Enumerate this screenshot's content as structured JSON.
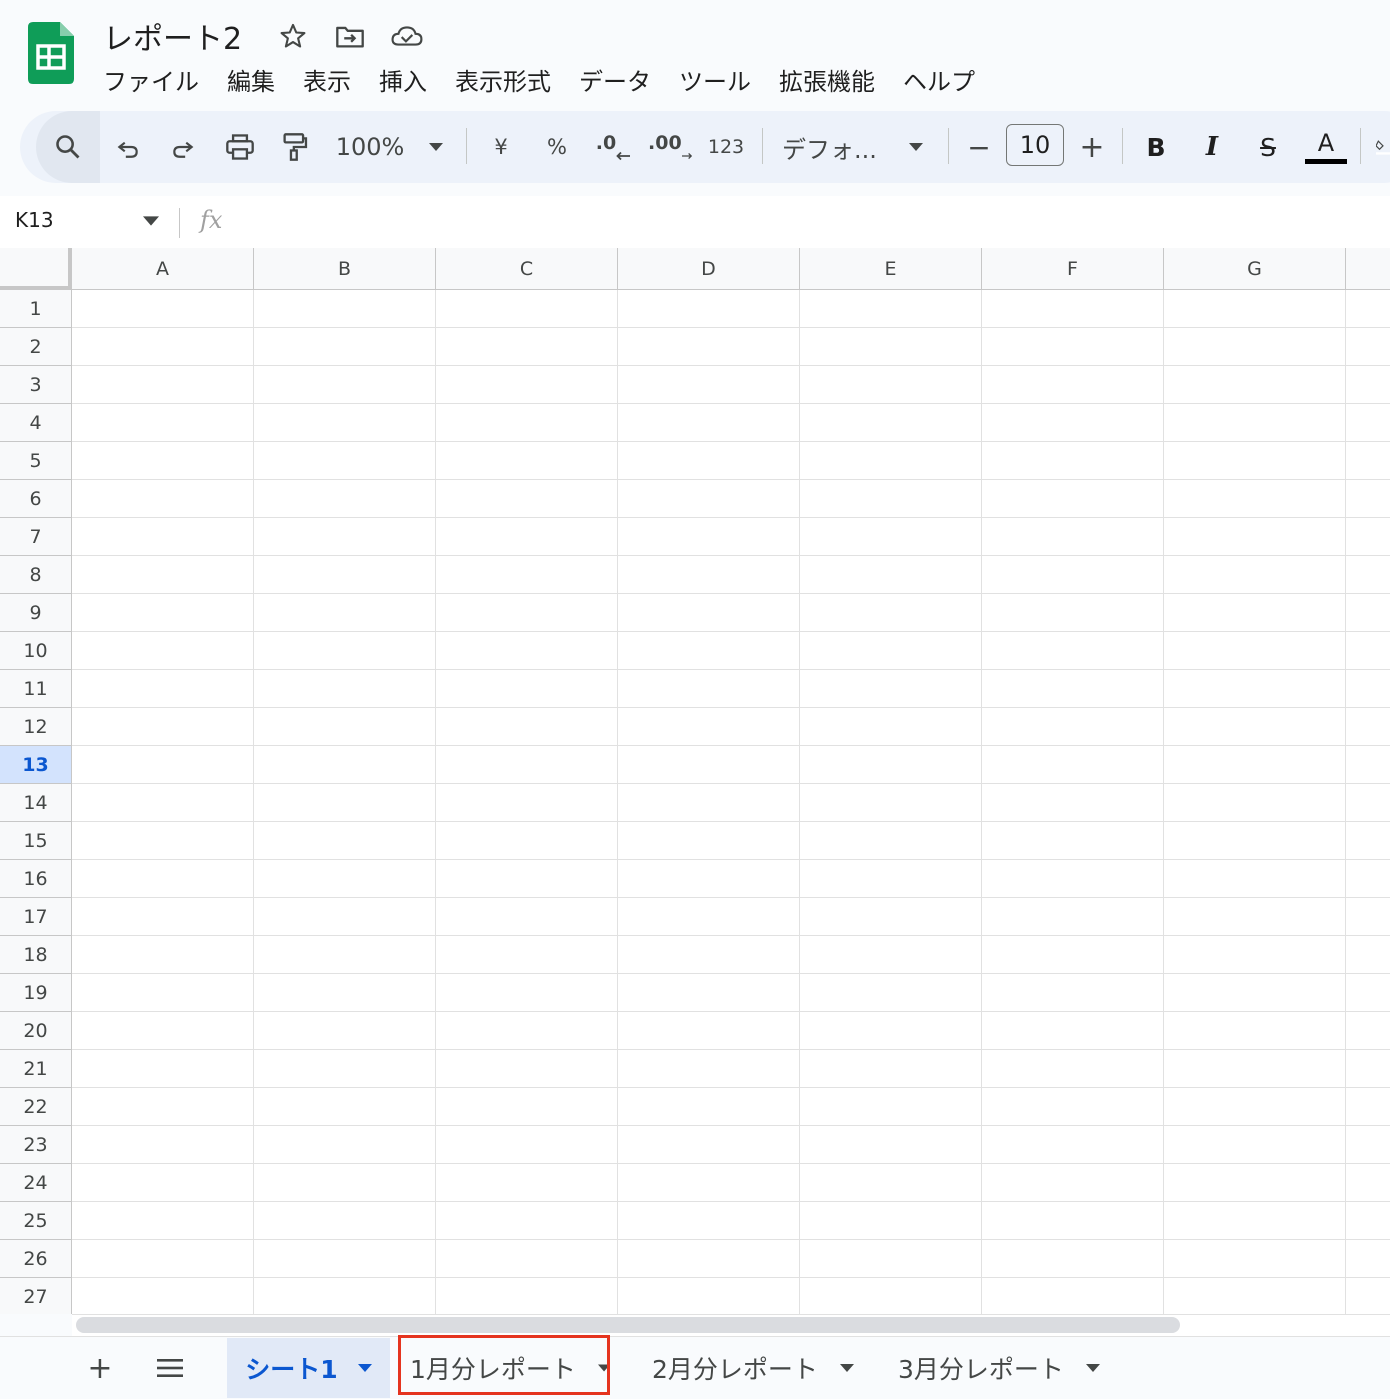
{
  "app": {
    "doc_title": "レポート2",
    "icons": [
      "star-icon",
      "move-folder-icon",
      "cloud-status-icon"
    ]
  },
  "menu": [
    "ファイル",
    "編集",
    "表示",
    "挿入",
    "表示形式",
    "データ",
    "ツール",
    "拡張機能",
    "ヘルプ"
  ],
  "toolbar": {
    "zoom": "100%",
    "currency": "¥",
    "percent": "%",
    "decrease_decimal": ".0",
    "increase_decimal": ".00",
    "number_format": "123",
    "font": "デフォ...",
    "minus": "−",
    "font_size": "10",
    "plus": "+",
    "bold": "B",
    "italic": "I",
    "strike": "S",
    "text_color": "A",
    "text_color_value": "#000000"
  },
  "formula_bar": {
    "name_box": "K13",
    "fx": "fx",
    "value": ""
  },
  "grid": {
    "columns": [
      "A",
      "B",
      "C",
      "D",
      "E",
      "F",
      "G"
    ],
    "rows": [
      "1",
      "2",
      "3",
      "4",
      "5",
      "6",
      "7",
      "8",
      "9",
      "10",
      "11",
      "12",
      "13",
      "14",
      "15",
      "16",
      "17",
      "18",
      "19",
      "20",
      "21",
      "22",
      "23",
      "24",
      "25",
      "26",
      "27"
    ],
    "selected_row": "13",
    "selected_cell": "K13"
  },
  "sheets": {
    "add_label": "+",
    "tabs": [
      {
        "label": "シート1",
        "active": true
      },
      {
        "label": "1月分レポート",
        "active": false,
        "highlighted": true
      },
      {
        "label": "2月分レポート",
        "active": false
      },
      {
        "label": "3月分レポート",
        "active": false
      }
    ]
  },
  "colors": {
    "accent": "#0b57d0",
    "sheets_green": "#0f9d58",
    "highlight_red": "#e5341f",
    "toolbar_bg": "#edf2fa",
    "selected_header_bg": "#d3e3fd"
  }
}
